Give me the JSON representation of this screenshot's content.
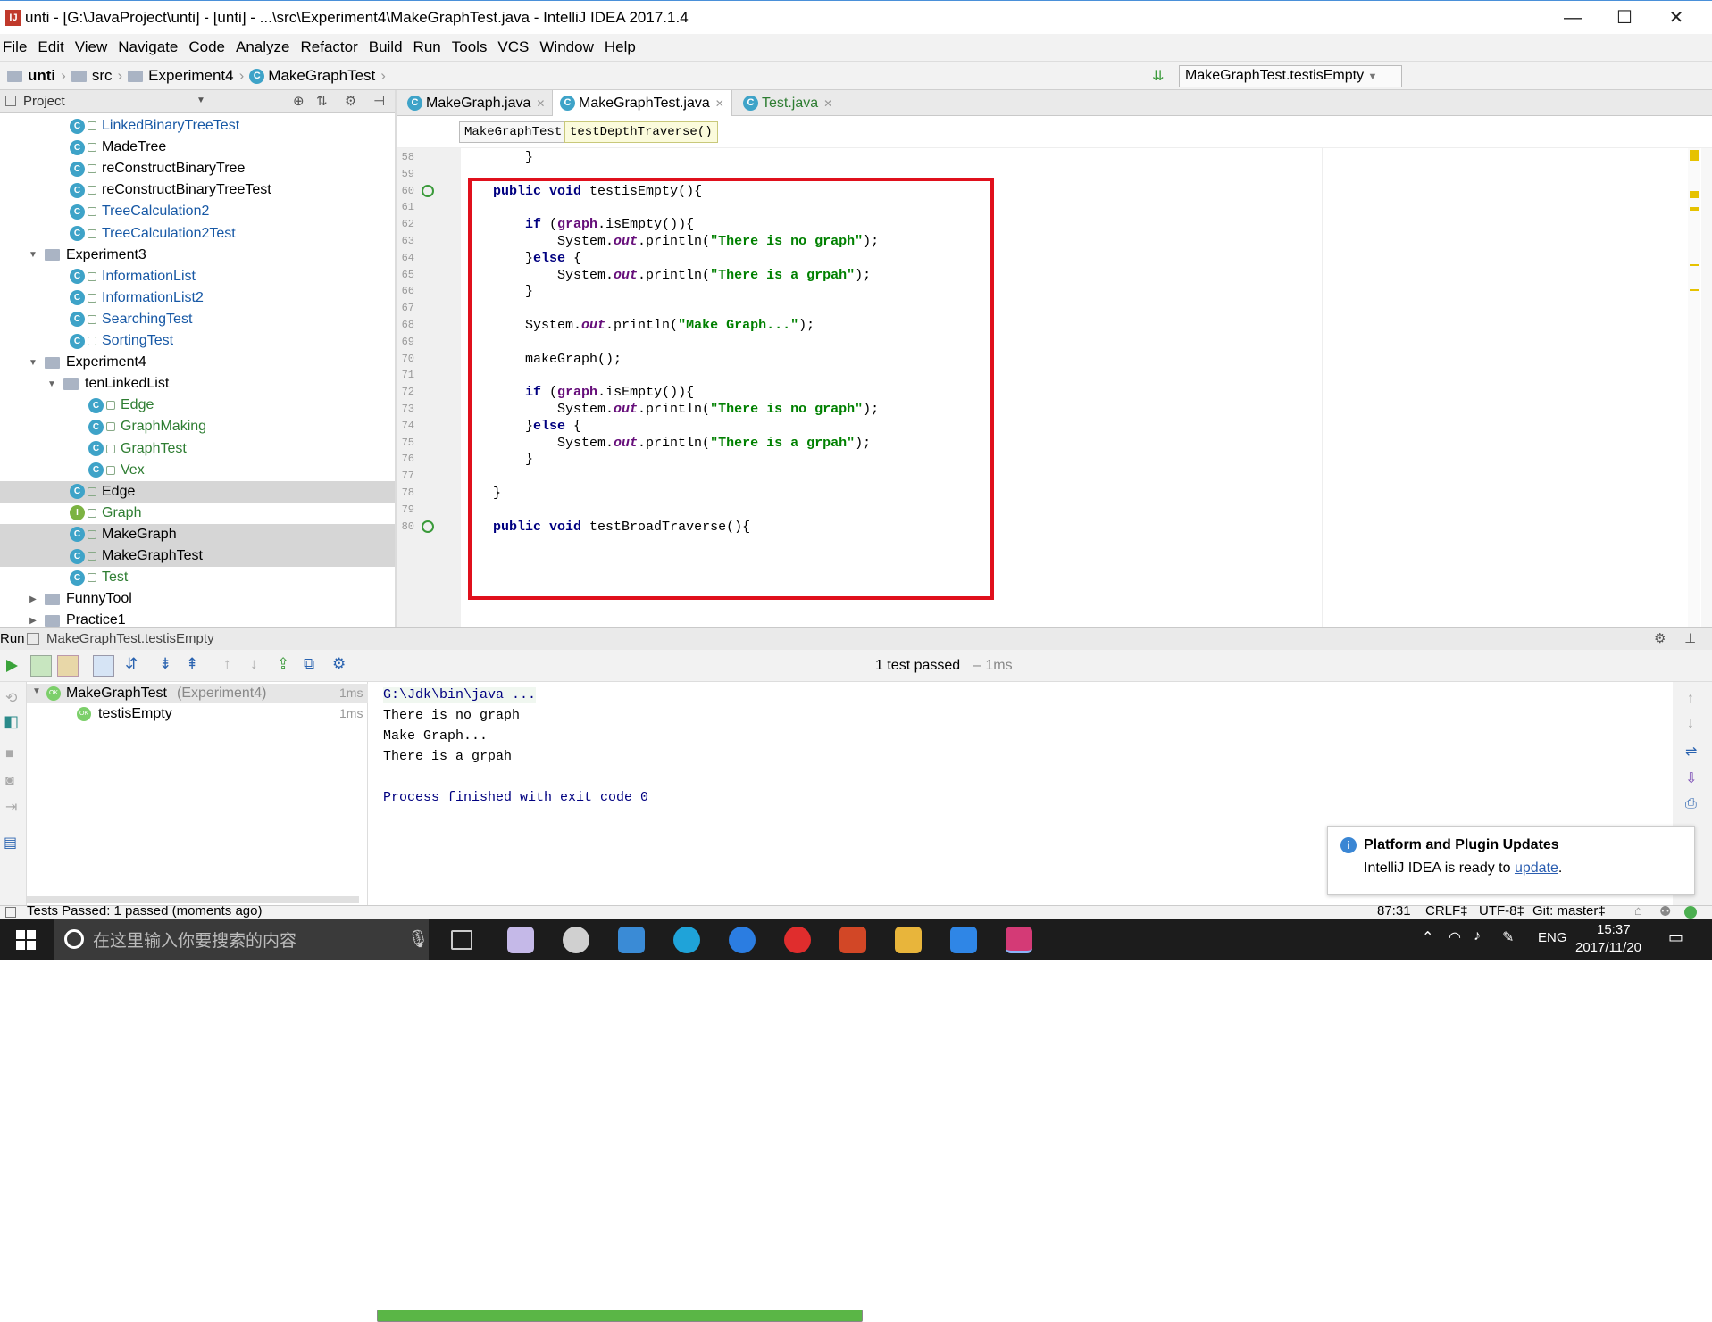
{
  "window": {
    "title": "unti - [G:\\JavaProject\\unti] - [unti] - ...\\src\\Experiment4\\MakeGraphTest.java - IntelliJ IDEA 2017.1.4"
  },
  "menu": [
    "File",
    "Edit",
    "View",
    "Navigate",
    "Code",
    "Analyze",
    "Refactor",
    "Build",
    "Run",
    "Tools",
    "VCS",
    "Window",
    "Help"
  ],
  "nav": {
    "crumbs": [
      "unti",
      "src",
      "Experiment4",
      "MakeGraphTest"
    ],
    "run_config": "MakeGraphTest.testisEmpty"
  },
  "project": {
    "header": "Project",
    "items": [
      {
        "label": "LinkedBinaryTreeTest",
        "kind": "c",
        "indent": 3,
        "color": "blue",
        "sel": false,
        "arrow": ""
      },
      {
        "label": "MadeTree",
        "kind": "c",
        "indent": 3,
        "color": "",
        "sel": false,
        "arrow": ""
      },
      {
        "label": "reConstructBinaryTree",
        "kind": "c",
        "indent": 3,
        "color": "",
        "sel": false,
        "arrow": ""
      },
      {
        "label": "reConstructBinaryTreeTest",
        "kind": "c",
        "indent": 3,
        "color": "",
        "sel": false,
        "arrow": ""
      },
      {
        "label": "TreeCalculation2",
        "kind": "c",
        "indent": 3,
        "color": "blue",
        "sel": false,
        "arrow": ""
      },
      {
        "label": "TreeCalculation2Test",
        "kind": "c",
        "indent": 3,
        "color": "blue",
        "sel": false,
        "arrow": ""
      },
      {
        "label": "Experiment3",
        "kind": "folder",
        "indent": 1,
        "color": "",
        "sel": false,
        "arrow": "▼"
      },
      {
        "label": "InformationList",
        "kind": "c",
        "indent": 3,
        "color": "blue",
        "sel": false,
        "arrow": ""
      },
      {
        "label": "InformationList2",
        "kind": "c",
        "indent": 3,
        "color": "blue",
        "sel": false,
        "arrow": ""
      },
      {
        "label": "SearchingTest",
        "kind": "c",
        "indent": 3,
        "color": "blue",
        "sel": false,
        "arrow": ""
      },
      {
        "label": "SortingTest",
        "kind": "c",
        "indent": 3,
        "color": "blue",
        "sel": false,
        "arrow": ""
      },
      {
        "label": "Experiment4",
        "kind": "folder",
        "indent": 1,
        "color": "",
        "sel": false,
        "arrow": "▼"
      },
      {
        "label": "tenLinkedList",
        "kind": "folder",
        "indent": 2,
        "color": "",
        "sel": false,
        "arrow": "▼"
      },
      {
        "label": "Edge",
        "kind": "c",
        "indent": 4,
        "color": "grn",
        "sel": false,
        "arrow": ""
      },
      {
        "label": "GraphMaking",
        "kind": "c",
        "indent": 4,
        "color": "grn",
        "sel": false,
        "arrow": ""
      },
      {
        "label": "GraphTest",
        "kind": "c",
        "indent": 4,
        "color": "grn",
        "sel": false,
        "arrow": ""
      },
      {
        "label": "Vex",
        "kind": "c",
        "indent": 4,
        "color": "grn",
        "sel": false,
        "arrow": ""
      },
      {
        "label": "Edge",
        "kind": "c",
        "indent": 3,
        "color": "",
        "sel": true,
        "arrow": ""
      },
      {
        "label": "Graph",
        "kind": "i",
        "indent": 3,
        "color": "grn",
        "sel": false,
        "arrow": ""
      },
      {
        "label": "MakeGraph",
        "kind": "c",
        "indent": 3,
        "color": "",
        "sel": true,
        "arrow": ""
      },
      {
        "label": "MakeGraphTest",
        "kind": "c",
        "indent": 3,
        "color": "",
        "sel": true,
        "arrow": ""
      },
      {
        "label": "Test",
        "kind": "c",
        "indent": 3,
        "color": "grn",
        "sel": false,
        "arrow": ""
      },
      {
        "label": "FunnyTool",
        "kind": "folder",
        "indent": 1,
        "color": "",
        "sel": false,
        "arrow": "▶"
      },
      {
        "label": "Practice1",
        "kind": "folder",
        "indent": 1,
        "color": "",
        "sel": false,
        "arrow": "▶"
      }
    ]
  },
  "tabs": [
    {
      "label": "MakeGraph.java",
      "active": false
    },
    {
      "label": "MakeGraphTest.java",
      "active": true
    },
    {
      "label": "Test.java",
      "active": false
    }
  ],
  "breadcrumb": [
    "MakeGraphTest",
    "testDepthTraverse()"
  ],
  "code": {
    "lines": [
      {
        "n": "58",
        "h": "        }"
      },
      {
        "n": "59",
        "h": ""
      },
      {
        "n": "60",
        "h": "    <span class='kw'>public void</span> testisEmpty(){"
      },
      {
        "n": "61",
        "h": ""
      },
      {
        "n": "62",
        "h": "        <span class='kw'>if</span> (<span class='fd'>graph</span>.isEmpty()){"
      },
      {
        "n": "63",
        "h": "            System.<span class='it'>out</span>.println(<span class='st'>\"There is no graph\"</span>);"
      },
      {
        "n": "64",
        "h": "        }<span class='kw'>else</span> {"
      },
      {
        "n": "65",
        "h": "            System.<span class='it'>out</span>.println(<span class='st'>\"There is a grpah\"</span>);"
      },
      {
        "n": "66",
        "h": "        }"
      },
      {
        "n": "67",
        "h": ""
      },
      {
        "n": "68",
        "h": "        System.<span class='it'>out</span>.println(<span class='st'>\"Make Graph...\"</span>);"
      },
      {
        "n": "69",
        "h": ""
      },
      {
        "n": "70",
        "h": "        makeGraph();"
      },
      {
        "n": "71",
        "h": ""
      },
      {
        "n": "72",
        "h": "        <span class='kw'>if</span> (<span class='fd'>graph</span>.isEmpty()){"
      },
      {
        "n": "73",
        "h": "            System.<span class='it'>out</span>.println(<span class='st'>\"There is no graph\"</span>);"
      },
      {
        "n": "74",
        "h": "        }<span class='kw'>else</span> {"
      },
      {
        "n": "75",
        "h": "            System.<span class='it'>out</span>.println(<span class='st'>\"There is a grpah\"</span>);"
      },
      {
        "n": "76",
        "h": "        }"
      },
      {
        "n": "77",
        "h": ""
      },
      {
        "n": "78",
        "h": "    }"
      },
      {
        "n": "79",
        "h": ""
      },
      {
        "n": "80",
        "h": "    <span class='kw'>public void</span> testBroadTraverse(){"
      }
    ]
  },
  "run": {
    "header_label": "Run",
    "config": "MakeGraphTest.testisEmpty",
    "result": "1 test passed",
    "result_time": "– 1ms",
    "tests": [
      {
        "label": "MakeGraphTest",
        "suffix": "(Experiment4)",
        "time": "1ms"
      },
      {
        "label": "testisEmpty",
        "suffix": "",
        "time": "1ms"
      }
    ],
    "console": [
      "G:\\Jdk\\bin\\java ...",
      "There is no graph",
      "Make Graph...",
      "There is a grpah",
      "",
      "Process finished with exit code 0"
    ]
  },
  "notification": {
    "title": "Platform and Plugin Updates",
    "text": "IntelliJ IDEA is ready to",
    "link": "update",
    "end": "."
  },
  "status": {
    "left": "Tests Passed: 1 passed (moments ago)",
    "pos": "87:31",
    "crlf": "CRLF‡",
    "enc": "UTF-8‡",
    "git": "Git: master‡"
  },
  "taskbar": {
    "search": "在这里输入你要搜索的内容",
    "lang": "ENG",
    "time": "15:37",
    "date": "2017/11/20"
  },
  "colors": {
    "accent": "#3ea3c8",
    "green": "#5ab646",
    "red": "#e0101c"
  }
}
